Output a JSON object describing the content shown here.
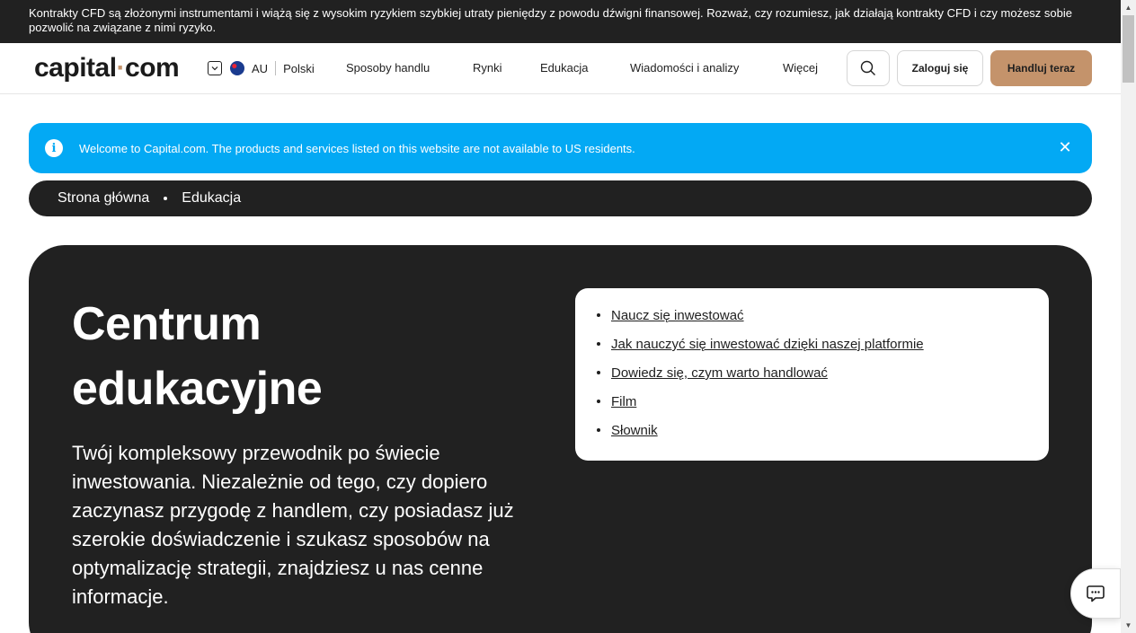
{
  "risk_warning": "Kontrakty CFD są złożonymi instrumentami i wiążą się z wysokim ryzykiem szybkiej utraty pieniędzy z powodu dźwigni finansowej. Rozważ, czy rozumiesz, jak działają kontrakty CFD i czy możesz sobie pozwolić na związane z nimi ryzyko.",
  "header": {
    "logo_main": "capital",
    "logo_dot": "·",
    "logo_tld": "com",
    "region": "AU",
    "language": "Polski",
    "nav": [
      "Sposoby handlu",
      "Rynki",
      "Edukacja",
      "Wiadomości i analizy",
      "Więcej"
    ],
    "login_label": "Zaloguj się",
    "trade_label": "Handluj teraz"
  },
  "info_banner": {
    "icon": "i",
    "text": "Welcome to Capital.com. The products and services listed on this website are not available to US residents.",
    "close": "✕"
  },
  "breadcrumb": [
    "Strona główna",
    "Edukacja"
  ],
  "hero": {
    "title_line1": "Centrum",
    "title_line2": "edukacyjne",
    "description": "Twój kompleksowy przewodnik po świecie inwestowania. Niezależnie od tego, czy dopiero zaczynasz przygodę z handlem, czy posiadasz już szerokie doświadczenie i szukasz sposobów na optymalizację strategii, znajdziesz u nas cenne informacje.",
    "links": [
      "Naucz się inwestować",
      "Jak nauczyć się inwestować dzięki naszej platformie",
      "Dowiedz się, czym warto handlować",
      "Film",
      "Słownik"
    ]
  },
  "icons": {
    "search": "search-icon",
    "chat": "chat-icon",
    "flag": "australia-flag-icon"
  },
  "colors": {
    "accent": "#c4936b",
    "dark": "#212121",
    "info": "#03a9f4"
  }
}
